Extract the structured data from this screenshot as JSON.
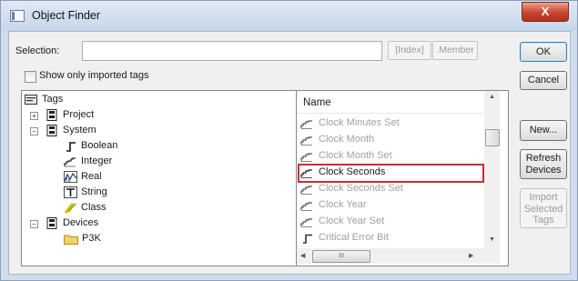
{
  "window": {
    "title": "Object Finder",
    "close_glyph": "X"
  },
  "selection": {
    "label": "Selection:",
    "value": "",
    "index_button": "[Index]",
    "member_button": ".Member"
  },
  "show_imported": {
    "label": "Show only imported tags",
    "checked": false
  },
  "buttons": {
    "ok": "OK",
    "cancel": "Cancel",
    "new": "New...",
    "refresh": [
      "Refresh",
      "Devices"
    ],
    "import": [
      "Import",
      "Selected",
      "Tags"
    ]
  },
  "tree": {
    "root": "Tags",
    "nodes": [
      {
        "label": "Project",
        "level": 1,
        "expander": "+",
        "icon": "module-icon"
      },
      {
        "label": "System",
        "level": 1,
        "expander": "−",
        "icon": "module-icon"
      },
      {
        "label": "Boolean",
        "level": 2,
        "icon": "boolean-icon"
      },
      {
        "label": "Integer",
        "level": 2,
        "icon": "integer-icon"
      },
      {
        "label": "Real",
        "level": 2,
        "icon": "real-icon"
      },
      {
        "label": "String",
        "level": 2,
        "icon": "string-icon"
      },
      {
        "label": "Class",
        "level": 2,
        "icon": "class-icon"
      },
      {
        "label": "Devices",
        "level": 1,
        "expander": "−",
        "icon": "module-icon"
      },
      {
        "label": "P3K",
        "level": 2,
        "icon": "folder-icon"
      }
    ]
  },
  "list": {
    "header": "Name",
    "items": [
      {
        "label": "Clock Minutes Set",
        "icon": "integer-icon"
      },
      {
        "label": "Clock Month",
        "icon": "integer-icon"
      },
      {
        "label": "Clock Month Set",
        "icon": "integer-icon"
      },
      {
        "label": "Clock Seconds",
        "icon": "integer-icon",
        "selected": true
      },
      {
        "label": "Clock Seconds Set",
        "icon": "integer-icon"
      },
      {
        "label": "Clock Year",
        "icon": "integer-icon"
      },
      {
        "label": "Clock Year Set",
        "icon": "integer-icon"
      },
      {
        "label": "Critical Error Bit",
        "icon": "boolean-icon"
      }
    ],
    "hscroll_thumb": "III"
  },
  "colors": {
    "selection_outline": "#c92d39",
    "close_red": "#c8442e",
    "dimmed_text": "#a0a0a0"
  }
}
